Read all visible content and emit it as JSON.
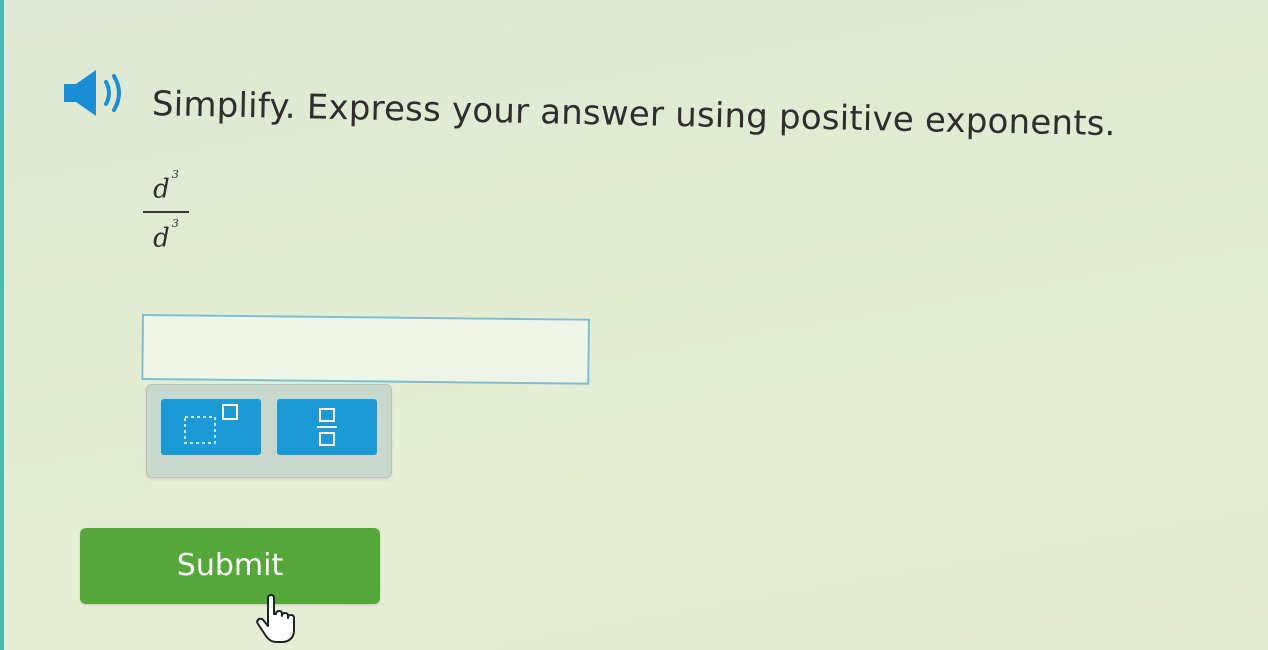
{
  "question": {
    "prompt": "Simplify. Express your answer using positive exponents.",
    "numerator_base": "d",
    "numerator_exponent": "3",
    "denominator_base": "d",
    "denominator_exponent": "3"
  },
  "answer": {
    "value": "",
    "placeholder": ""
  },
  "palette": {
    "buttons": [
      "exponent-template",
      "fraction-template"
    ]
  },
  "submit": {
    "label": "Submit"
  },
  "colors": {
    "accent_blue": "#1b9ad6",
    "submit_green": "#55a73a",
    "input_border": "#7bbfd6",
    "background": "#e2ecd2"
  },
  "icons": [
    "speaker-icon",
    "exponent-template-icon",
    "fraction-template-icon",
    "hand-pointer-cursor-icon"
  ]
}
